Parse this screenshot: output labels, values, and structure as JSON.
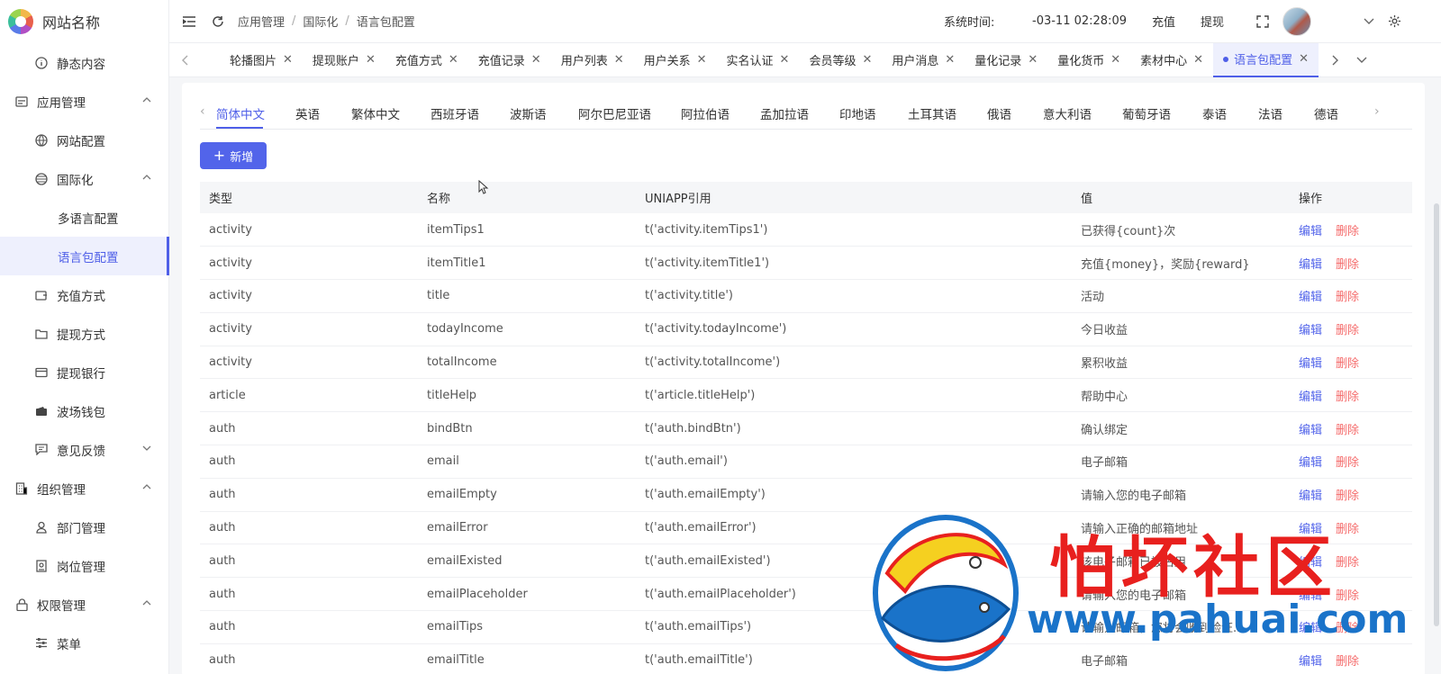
{
  "app": {
    "site_name": "网站名称"
  },
  "sidebar": {
    "items": [
      {
        "label": "静态内容",
        "icon": "info-circle-icon",
        "level": 2
      },
      {
        "label": "应用管理",
        "icon": "app-window-icon",
        "level": 1,
        "expanded": true
      },
      {
        "label": "网站配置",
        "icon": "globe-icon",
        "level": 2
      },
      {
        "label": "国际化",
        "icon": "globe-grid-icon",
        "level": 2,
        "expanded": true
      },
      {
        "label": "多语言配置",
        "level": 3
      },
      {
        "label": "语言包配置",
        "level": 3,
        "active": true
      },
      {
        "label": "充值方式",
        "icon": "wallet-in-icon",
        "level": 2
      },
      {
        "label": "提现方式",
        "icon": "folder-icon",
        "level": 2
      },
      {
        "label": "提现银行",
        "icon": "card-icon",
        "level": 2
      },
      {
        "label": "波场钱包",
        "icon": "wallet-icon",
        "level": 2
      },
      {
        "label": "意见反馈",
        "icon": "message-icon",
        "level": 2,
        "collapsed": true
      },
      {
        "label": "组织管理",
        "icon": "building-icon",
        "level": 1,
        "expanded": true
      },
      {
        "label": "部门管理",
        "icon": "user-icon",
        "level": 2
      },
      {
        "label": "岗位管理",
        "icon": "badge-icon",
        "level": 2
      },
      {
        "label": "权限管理",
        "icon": "lock-icon",
        "level": 1,
        "expanded": true
      },
      {
        "label": "菜单",
        "icon": "sliders-icon",
        "level": 2
      }
    ]
  },
  "header": {
    "breadcrumb": [
      "应用管理",
      "国际化",
      "语言包配置"
    ],
    "sys_time_label": "系统时间:",
    "sys_time": "-03-11 02:28:09",
    "recharge": "充值",
    "withdraw": "提现"
  },
  "tabs": [
    {
      "label": "轮播图片"
    },
    {
      "label": "提现账户"
    },
    {
      "label": "充值方式"
    },
    {
      "label": "充值记录"
    },
    {
      "label": "用户列表"
    },
    {
      "label": "用户关系"
    },
    {
      "label": "实名认证"
    },
    {
      "label": "会员等级"
    },
    {
      "label": "用户消息"
    },
    {
      "label": "量化记录"
    },
    {
      "label": "量化货币"
    },
    {
      "label": "素材中心"
    },
    {
      "label": "语言包配置",
      "active": true
    }
  ],
  "languages": [
    "简体中文",
    "英语",
    "繁体中文",
    "西班牙语",
    "波斯语",
    "阿尔巴尼亚语",
    "阿拉伯语",
    "孟加拉语",
    "印地语",
    "土耳其语",
    "俄语",
    "意大利语",
    "葡萄牙语",
    "泰语",
    "法语",
    "德语"
  ],
  "active_language": "简体中文",
  "toolbar": {
    "add_label": "新增"
  },
  "table": {
    "columns": [
      "类型",
      "名称",
      "UNIAPP引用",
      "值",
      "操作"
    ],
    "edit_label": "编辑",
    "delete_label": "删除",
    "rows": [
      {
        "type": "activity",
        "name": "itemTips1",
        "ref": "t('activity.itemTips1')",
        "value": "已获得{count}次"
      },
      {
        "type": "activity",
        "name": "itemTitle1",
        "ref": "t('activity.itemTitle1')",
        "value": "充值{money}，奖励{reward}"
      },
      {
        "type": "activity",
        "name": "title",
        "ref": "t('activity.title')",
        "value": "活动"
      },
      {
        "type": "activity",
        "name": "todayIncome",
        "ref": "t('activity.todayIncome')",
        "value": "今日收益"
      },
      {
        "type": "activity",
        "name": "totalIncome",
        "ref": "t('activity.totalIncome')",
        "value": "累积收益"
      },
      {
        "type": "article",
        "name": "titleHelp",
        "ref": "t('article.titleHelp')",
        "value": "帮助中心"
      },
      {
        "type": "auth",
        "name": "bindBtn",
        "ref": "t('auth.bindBtn')",
        "value": "确认绑定"
      },
      {
        "type": "auth",
        "name": "email",
        "ref": "t('auth.email')",
        "value": "电子邮箱"
      },
      {
        "type": "auth",
        "name": "emailEmpty",
        "ref": "t('auth.emailEmpty')",
        "value": "请输入您的电子邮箱"
      },
      {
        "type": "auth",
        "name": "emailError",
        "ref": "t('auth.emailError')",
        "value": "请输入正确的邮箱地址"
      },
      {
        "type": "auth",
        "name": "emailExisted",
        "ref": "t('auth.emailExisted')",
        "value": "该电子邮箱已被占用"
      },
      {
        "type": "auth",
        "name": "emailPlaceholder",
        "ref": "t('auth.emailPlaceholder')",
        "value": "请输入您的电子邮箱"
      },
      {
        "type": "auth",
        "name": "emailTips",
        "ref": "t('auth.emailTips')",
        "value": "请输入邮箱，您将会收到验证..."
      },
      {
        "type": "auth",
        "name": "emailTitle",
        "ref": "t('auth.emailTitle')",
        "value": "电子邮箱"
      }
    ]
  },
  "watermark": {
    "text": "怕坏社区",
    "url": "www.pahuai.com"
  },
  "colors": {
    "accent": "#5264ea",
    "danger": "#f56c6c",
    "active_bg": "#eef0fd",
    "watermark_red": "#e8201e",
    "watermark_blue": "#1a73c9"
  }
}
